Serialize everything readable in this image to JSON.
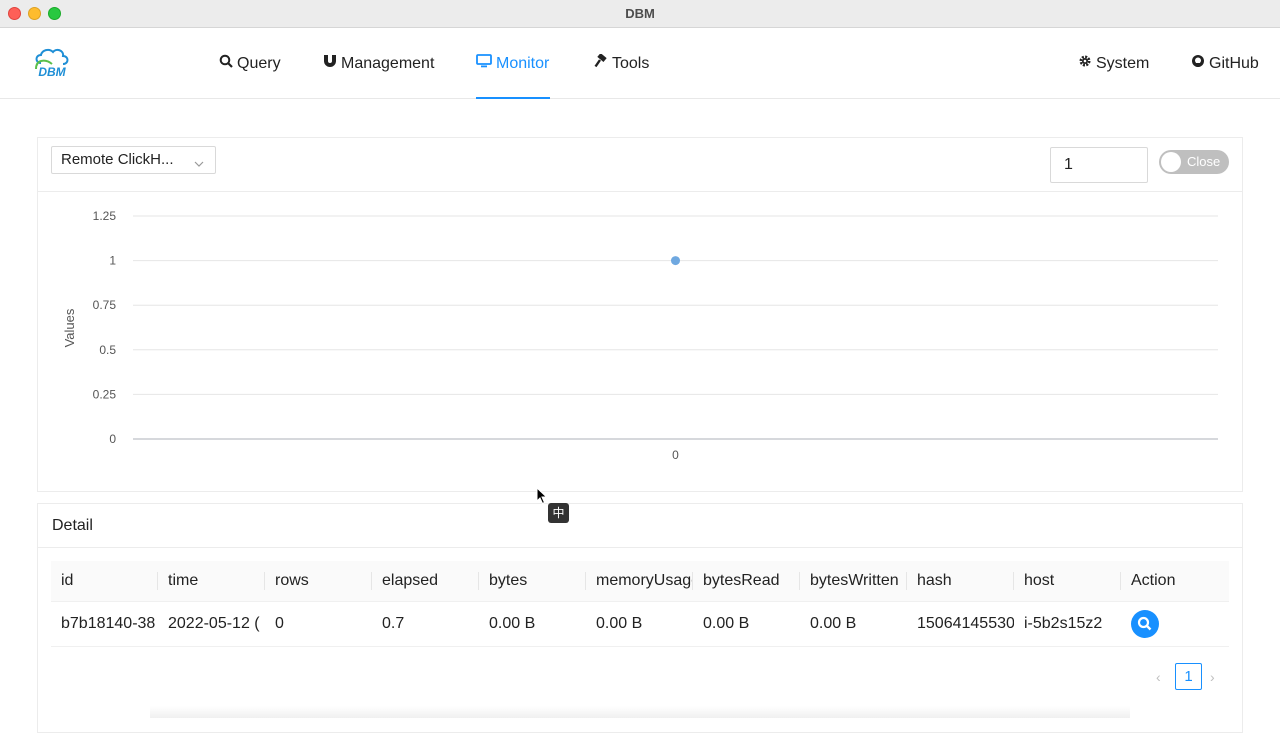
{
  "window": {
    "title": "DBM"
  },
  "nav": {
    "logo_text": "DBM",
    "items": [
      {
        "label": "Query",
        "icon": "search-icon"
      },
      {
        "label": "Management",
        "icon": "magnet-icon"
      },
      {
        "label": "Monitor",
        "icon": "monitor-icon",
        "active": true
      },
      {
        "label": "Tools",
        "icon": "hammer-icon"
      }
    ],
    "right_items": [
      {
        "label": "System",
        "icon": "gear-icon"
      },
      {
        "label": "GitHub",
        "icon": "github-icon"
      }
    ]
  },
  "monitor": {
    "source_select": "Remote ClickH...",
    "interval_value": "1",
    "toggle_label": "Close"
  },
  "chart_data": {
    "type": "scatter",
    "x": [
      0
    ],
    "y": [
      1
    ],
    "xticks": [
      "0"
    ],
    "yticks": [
      "1.25",
      "1",
      "0.75",
      "0.5",
      "0.25",
      "0"
    ],
    "ylabel": "Values",
    "ylim": [
      0,
      1.25
    ],
    "grid": true,
    "point_color": "#6fa8e0"
  },
  "detail": {
    "title": "Detail",
    "columns": [
      "id",
      "time",
      "rows",
      "elapsed",
      "bytes",
      "memoryUsage",
      "bytesRead",
      "bytesWritten",
      "hash",
      "host",
      "Action"
    ],
    "rows": [
      [
        "b7b18140-38",
        "2022-05-12 (",
        "0",
        "0.7",
        "0.00 B",
        "0.00 B",
        "0.00 B",
        "0.00 B",
        "15064145530",
        "i-5b2s15z2"
      ]
    ],
    "pagination": {
      "current": "1"
    }
  },
  "ime_indicator": "中",
  "colors": {
    "accent": "#1890ff",
    "toggle_off": "#bfbfbf"
  }
}
